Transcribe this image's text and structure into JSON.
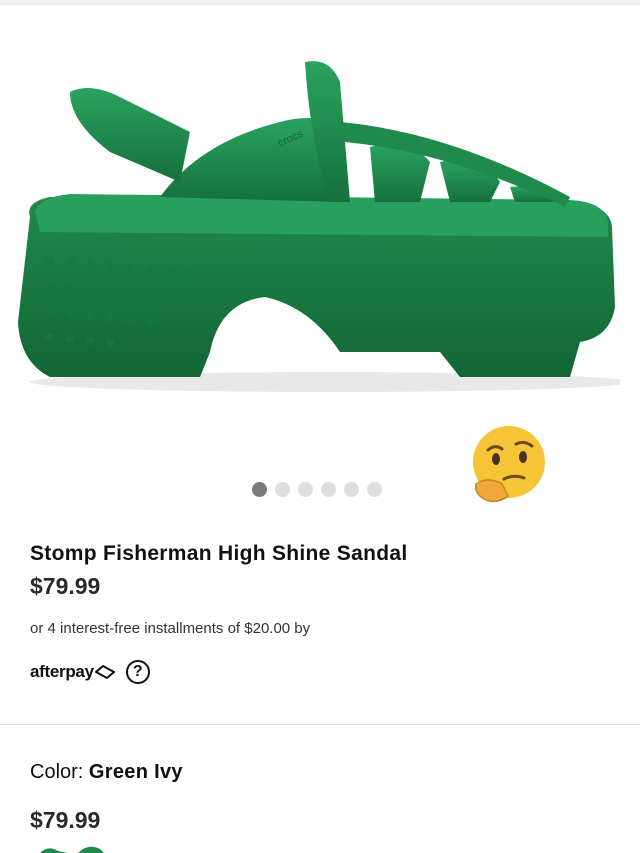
{
  "product": {
    "image_name": "green-fisherman-sandal",
    "brand_mark": "crocs",
    "title": "Stomp Fisherman High Shine Sandal",
    "price": "$79.99",
    "installments_text": "or 4 interest-free installments of $20.00 by",
    "afterpay_label": "afterpay",
    "help_glyph": "?"
  },
  "carousel": {
    "total": 6,
    "active_index": 0
  },
  "sticker": {
    "icon": "thinking-face-icon"
  },
  "variant": {
    "color_label": "Color:",
    "color_value": "Green Ivy",
    "price": "$79.99"
  },
  "colors": {
    "accent": "#1f8a4c",
    "dot_active": "#7a7a7a",
    "dot_inactive": "#dedede"
  }
}
